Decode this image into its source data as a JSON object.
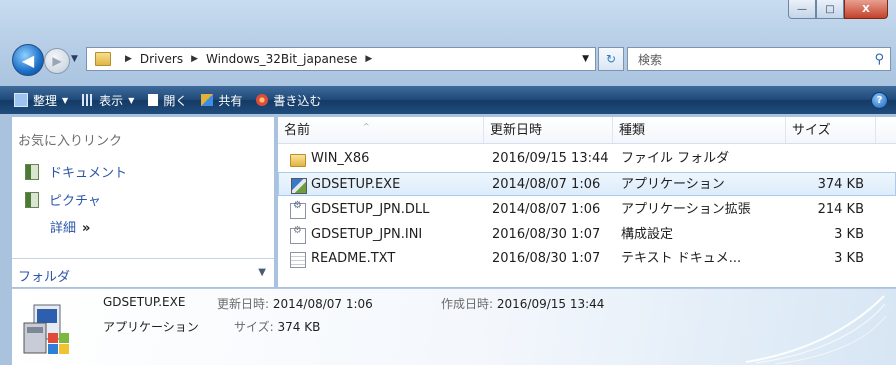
{
  "window": {
    "caption_buttons": [
      {
        "name": "minimize-button",
        "glyph": "—"
      },
      {
        "name": "maximize-button",
        "glyph": "□"
      },
      {
        "name": "close-button",
        "glyph": "X"
      }
    ]
  },
  "nav": {
    "back_glyph": "◀",
    "forward_glyph": "▶",
    "breadcrumbs": [
      "Drivers",
      "Windows_32Bit_japanese"
    ],
    "refresh_glyph": "↻",
    "search_placeholder": "検索",
    "search_icon_glyph": "⚲"
  },
  "toolbar": {
    "items": [
      {
        "label": "整理",
        "has_arrow": true,
        "icon_color": "#9fc3ef"
      },
      {
        "label": "表示",
        "has_arrow": true,
        "icon_color": "#d8e6f6"
      },
      {
        "label": "開く",
        "has_arrow": false,
        "icon_color": "#ffffff"
      },
      {
        "label": "共有",
        "has_arrow": false,
        "icon_color": "#e2b13a"
      },
      {
        "label": "書き込む",
        "has_arrow": false,
        "icon_color": "#e04a3a"
      }
    ],
    "help_glyph": "?"
  },
  "sidebar": {
    "heading": "お気に入りリンク",
    "links": [
      "ドキュメント",
      "ピクチャ"
    ],
    "more_label": "詳細",
    "more_glyph": "»",
    "folders_label": "フォルダ",
    "folders_chevron": "⌄"
  },
  "filelist": {
    "columns": [
      "名前",
      "更新日時",
      "種類",
      "サイズ"
    ],
    "sort_glyph": "^",
    "rows": [
      {
        "name": "WIN_X86",
        "date": "2016/09/15 13:44",
        "type": "ファイル フォルダ",
        "size": "",
        "icon": "folder"
      },
      {
        "name": "GDSETUP.EXE",
        "date": "2014/08/07 1:06",
        "type": "アプリケーション",
        "size": "374 KB",
        "icon": "exe",
        "selected": true
      },
      {
        "name": "GDSETUP_JPN.DLL",
        "date": "2014/08/07 1:06",
        "type": "アプリケーション拡張",
        "size": "214 KB",
        "icon": "dll"
      },
      {
        "name": "GDSETUP_JPN.INI",
        "date": "2016/08/30 1:07",
        "type": "構成設定",
        "size": "3 KB",
        "icon": "ini"
      },
      {
        "name": "README.TXT",
        "date": "2016/08/30 1:07",
        "type": "テキスト ドキュメ...",
        "size": "3 KB",
        "icon": "txt"
      }
    ]
  },
  "details": {
    "filename": "GDSETUP.EXE",
    "modified_label": "更新日時:",
    "modified_value": "2014/08/07 1:06",
    "created_label": "作成日時:",
    "created_value": "2016/09/15 13:44",
    "type_value": "アプリケーション",
    "size_label": "サイズ:",
    "size_value": "374 KB"
  }
}
